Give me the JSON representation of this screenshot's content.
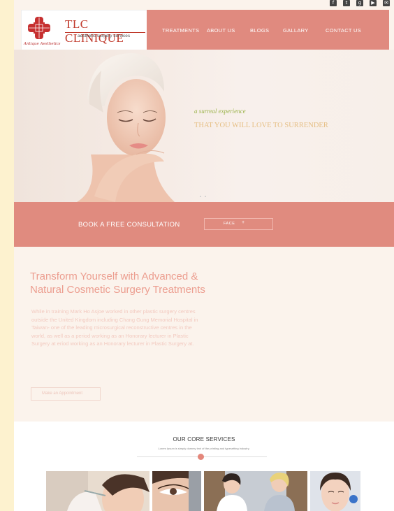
{
  "social": {
    "icons": [
      {
        "name": "facebook-icon",
        "glyph": "f"
      },
      {
        "name": "twitter-icon",
        "glyph": "t"
      },
      {
        "name": "googleplus-icon",
        "glyph": "g"
      },
      {
        "name": "youtube-icon",
        "glyph": "▶"
      },
      {
        "name": "email-icon",
        "glyph": "✉"
      }
    ]
  },
  "brand": {
    "title": "TLC CLINIQUE",
    "subtitle": "aesthetic surgery services",
    "script": "Antique Aesthetics",
    "accent": "#c0392b"
  },
  "nav": {
    "items": [
      {
        "label": "TREATMENTS"
      },
      {
        "label": "ABOUT US"
      },
      {
        "label": "BLOGS"
      },
      {
        "label": "GALLARY"
      },
      {
        "label": "CONTACT US"
      }
    ],
    "background": "#e08a7f"
  },
  "hero": {
    "tagline_italic": "a surreal experience",
    "tagline_main": "THAT YOU WILL LOVE TO SURRENDER"
  },
  "consult": {
    "label": "BOOK A FREE CONSULTATION",
    "select_value": "FACE",
    "select_caret": "+"
  },
  "intro": {
    "title": "Transform Yourself with Advanced & Natural Cosmetic Surgery Treatments",
    "body": "While in training Mark Ho Asjoe worked in other plastic surgery centres outside the United Kingdom including Chang Gung Memorial Hospital in Taiwan- one of the leading microsurgical reconstructive centres in the world, as well as a period working as an Honorary lecturer in Plastic Surgery at eriod working as an Honorary lecturer in Plastic Surgery at.",
    "button": "Make an Appointment"
  },
  "services": {
    "title": "OUR CORE SERVICES",
    "subtitle": "Lorem Ipsum is simply dummy text of the printing and typesetting industry."
  }
}
